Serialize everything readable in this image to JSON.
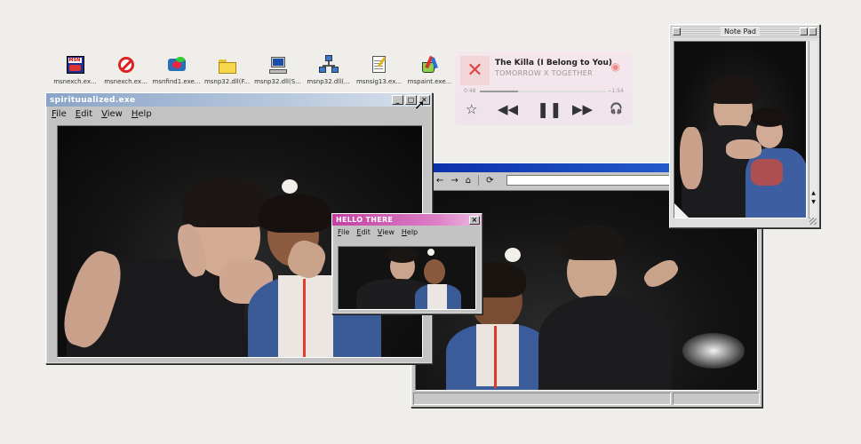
{
  "desktop_icons": [
    {
      "name": "msnexch-icon",
      "label": "msnexch.ex..."
    },
    {
      "name": "prohibited-icon",
      "label": "msnexch.ex..."
    },
    {
      "name": "msnfind-icon",
      "label": "msnfind1.exe..."
    },
    {
      "name": "folder-icon",
      "label": "msnp32.dll(F..."
    },
    {
      "name": "computer-icon",
      "label": "msnp32.dll(S..."
    },
    {
      "name": "network-icon",
      "label": "msnp32.dll(..."
    },
    {
      "name": "notepad-file-icon",
      "label": "msnsig13.ex..."
    },
    {
      "name": "paint-icon",
      "label": "mspaint.exe..."
    }
  ],
  "main_window": {
    "title": "spirituualized.exe",
    "menu": [
      "File",
      "Edit",
      "View",
      "Help"
    ]
  },
  "hello_window": {
    "title": "HELLO THERE",
    "menu": [
      "File",
      "Edit",
      "View",
      "Help"
    ],
    "close": "×"
  },
  "player": {
    "song": "The Killa (I Belong to You)",
    "artist": "TOMORROW X TOGETHER",
    "elapsed": "0:48",
    "remaining": "−1:54",
    "progress": 0.3,
    "accent": "#d94b4b"
  },
  "notepad": {
    "title": "Note Pad"
  }
}
